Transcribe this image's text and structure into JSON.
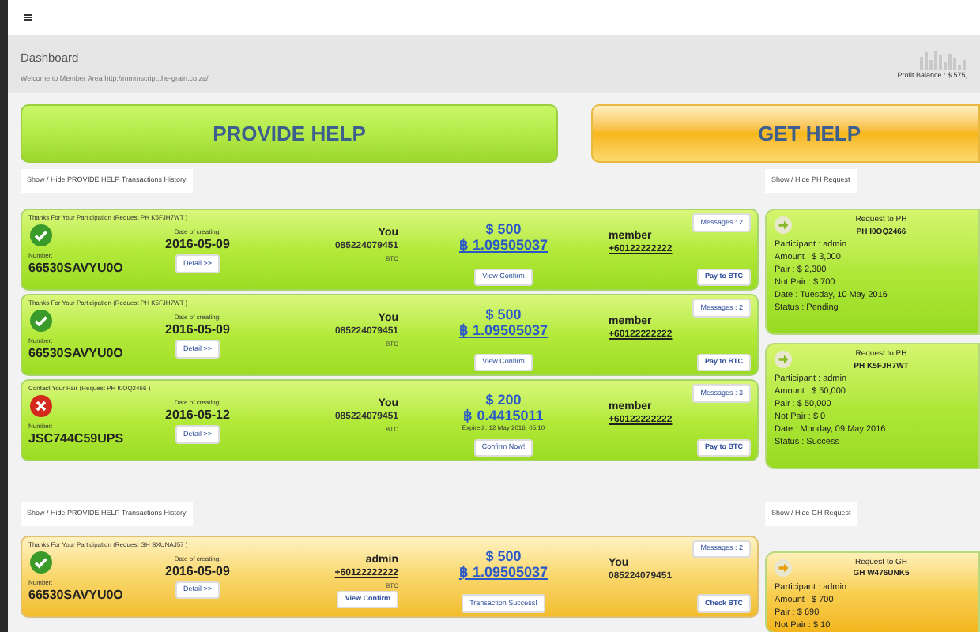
{
  "header": {
    "title": "Dashboard",
    "welcome": "Welcome to Member Area http://mmmscript.the-grain.co.za/",
    "balance": "Profit Balance : $ 575,"
  },
  "provide_button": "PROVIDE HELP",
  "get_button": "GET HELP",
  "sections": [
    {
      "kind": "ph",
      "toggle": "Show / Hide PROVIDE HELP Transactions History",
      "side_toggle": "Show / Hide PH Request",
      "transactions": [
        {
          "failed": false,
          "title": "Thanks For Your Participation (Request PH K5FJH7WT )",
          "number_label": "Number:",
          "number": "66530SAVYU0O",
          "date_label": "Date of creating:",
          "date": "2016-05-09",
          "detail": "Detail >>",
          "left_name": "You",
          "left_phone": "085224079451",
          "left_phone_link": false,
          "currency": "BTC",
          "usd": "$ 500",
          "btc": "฿ 1.09505037",
          "btc_link": true,
          "action": "View Confirm",
          "right_name": "member",
          "right_phone": "+60122222222",
          "right_phone_link": true,
          "messages": "Messages : 2",
          "pay": "Pay to BTC"
        },
        {
          "failed": false,
          "title": "Thanks For Your Participation (Request PH K5FJH7WT )",
          "number_label": "Number:",
          "number": "66530SAVYU0O",
          "date_label": "Date of creating:",
          "date": "2016-05-09",
          "detail": "Detail >>",
          "left_name": "You",
          "left_phone": "085224079451",
          "left_phone_link": false,
          "currency": "BTC",
          "usd": "$ 500",
          "btc": "฿ 1.09505037",
          "btc_link": true,
          "action": "View Confirm",
          "right_name": "member",
          "right_phone": "+60122222222",
          "right_phone_link": true,
          "messages": "Messages : 2",
          "pay": "Pay to BTC"
        },
        {
          "failed": true,
          "title": "Contact Your Pair (Request PH I0OQ2466 )",
          "number_label": "Number:",
          "number": "JSC744C59UPS",
          "date_label": "Date of creating:",
          "date": "2016-05-12",
          "detail": "Detail >>",
          "left_name": "You",
          "left_phone": "085224079451",
          "left_phone_link": false,
          "currency": "BTC",
          "usd": "$ 200",
          "btc": "฿ 0.4415011",
          "btc_link": false,
          "expired": "Expired : 12 May 2016, 05:10",
          "action": "Confirm Now!",
          "right_name": "member",
          "right_phone": "+60122222222",
          "right_phone_link": true,
          "messages": "Messages : 3",
          "pay": "Pay to BTC"
        }
      ],
      "requests": [
        {
          "title": "Request to PH",
          "id": "PH I0OQ2466",
          "lines": [
            "Participant : admin",
            "Amount : $ 3,000",
            "Pair : $ 2,300",
            "Not Pair : $ 700",
            "Date : Tuesday, 10 May 2016",
            "Status : Pending"
          ]
        },
        {
          "title": "Request to PH",
          "id": "PH K5FJH7WT",
          "lines": [
            "Participant : admin",
            "Amount : $ 50,000",
            "Pair : $ 50,000",
            "Not Pair : $ 0",
            "Date : Monday, 09 May 2016",
            "Status : Success"
          ]
        }
      ]
    },
    {
      "kind": "gh",
      "toggle": "Show / Hide PROVIDE HELP Transactions History",
      "side_toggle": "Show / Hide GH Request",
      "transactions": [
        {
          "failed": false,
          "title": "Thanks For Your Participation (Request GH SXUNAJ57 )",
          "number_label": "Number:",
          "number": "66530SAVYU0O",
          "date_label": "Date of creating:",
          "date": "2016-05-09",
          "detail": "Detail >>",
          "left_name": "admin",
          "left_phone": "+60122222222",
          "left_phone_link": true,
          "currency": "BTC",
          "usd": "$ 500",
          "btc": "฿ 1.09505037",
          "btc_link": true,
          "action": "View Confirm",
          "action2": "Transaction Success!",
          "right_name": "You",
          "right_phone": "085224079451",
          "right_phone_link": false,
          "messages": "Messages : 2",
          "pay": "Check BTC"
        }
      ],
      "requests": [
        {
          "title": "Request to GH",
          "id": "GH W476UNK5",
          "lines": [
            "Participant : admin",
            "Amount : $ 700",
            "Pair : $ 690",
            "Not Pair : $ 10"
          ]
        }
      ]
    }
  ]
}
